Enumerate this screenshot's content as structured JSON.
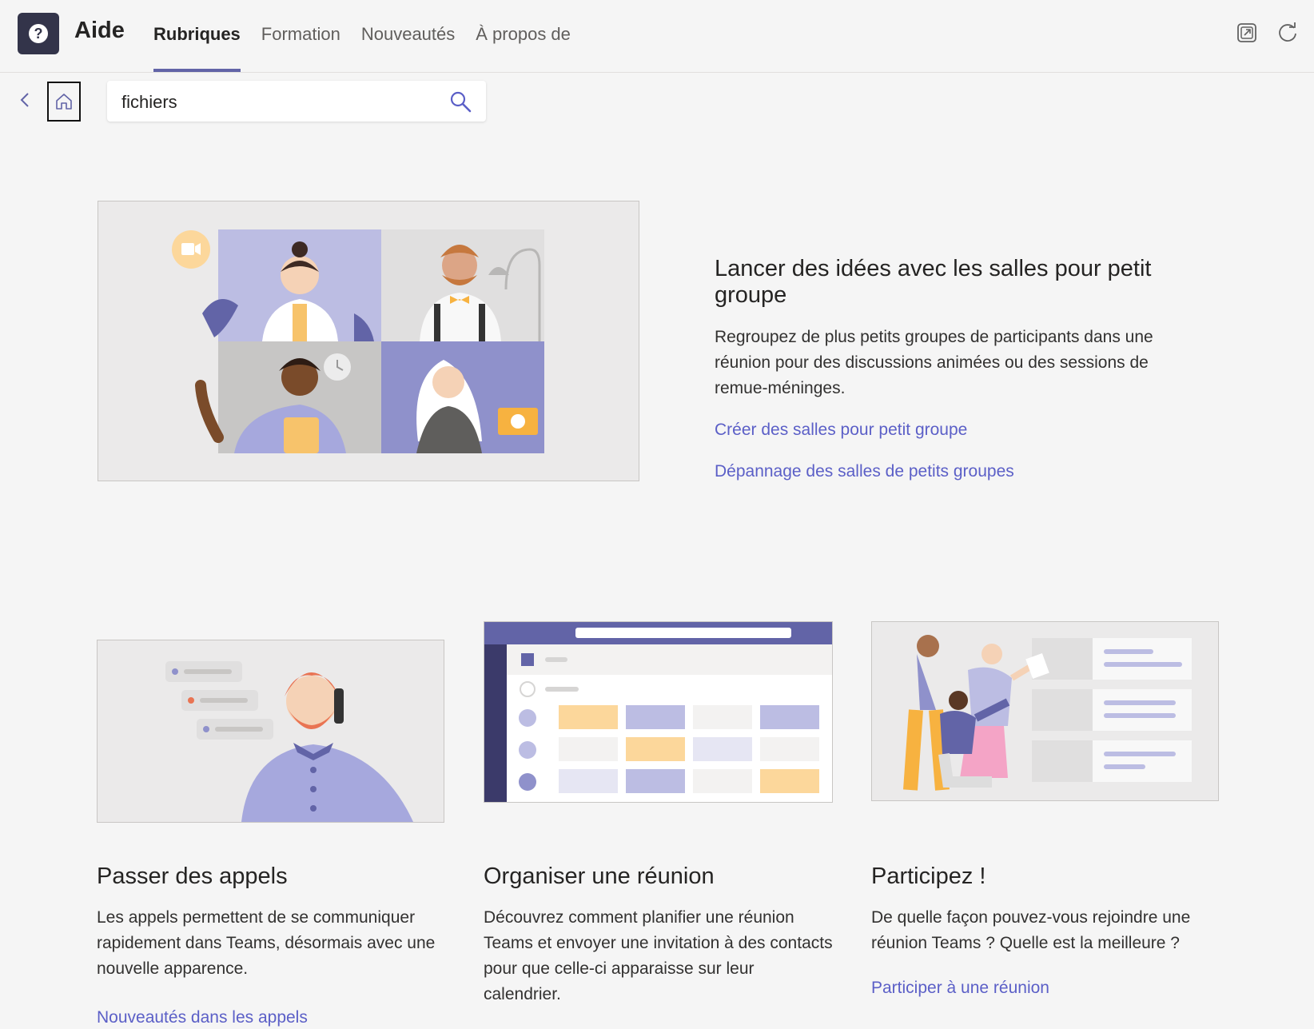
{
  "header": {
    "app_name": "Aide",
    "tabs": [
      {
        "label": "Rubriques",
        "active": true
      },
      {
        "label": "Formation",
        "active": false
      },
      {
        "label": "Nouveautés",
        "active": false
      },
      {
        "label": "À propos de",
        "active": false
      }
    ],
    "icons": [
      "help-icon",
      "popout-icon",
      "refresh-icon"
    ]
  },
  "search": {
    "value": "fichiers"
  },
  "hero": {
    "title": "Lancer des idées avec les salles pour petit groupe",
    "description": "Regroupez de plus petits groupes de participants dans une réunion pour des discussions animées ou des sessions de remue-méninges.",
    "links": [
      "Créer des salles pour petit groupe",
      "Dépannage des salles de petits groupes"
    ]
  },
  "cards": [
    {
      "title": "Passer des appels",
      "description": "Les appels permettent de se communiquer rapidement dans Teams, désormais avec une nouvelle apparence.",
      "link": "Nouveautés dans les appels"
    },
    {
      "title": "Organiser une réunion",
      "description": "Découvrez comment planifier une réunion Teams et envoyer une invitation à des contacts pour que celle-ci apparaisse sur leur calendrier."
    },
    {
      "title": "Participez !",
      "description": "De quelle façon pouvez-vous rejoindre une réunion Teams ? Quelle est la meilleure ?",
      "link": "Participer à une réunion"
    }
  ],
  "colors": {
    "accent": "#6264a7",
    "link": "#5b5fc7",
    "app_icon_bg": "#33344a",
    "background": "#f5f5f5"
  }
}
